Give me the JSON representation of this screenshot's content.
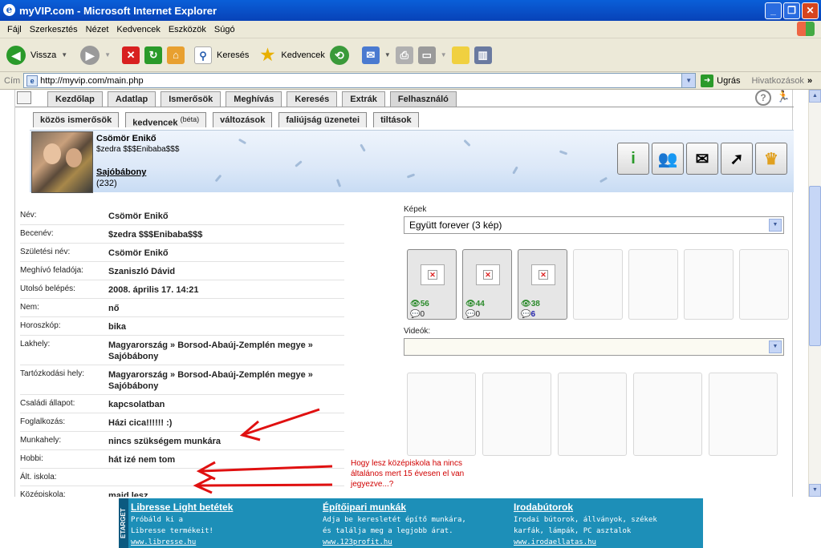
{
  "window": {
    "title": "myVIP.com - Microsoft Internet Explorer"
  },
  "menu": [
    "Fájl",
    "Szerkesztés",
    "Nézet",
    "Kedvencek",
    "Eszközök",
    "Súgó"
  ],
  "toolbar": {
    "back": "Vissza",
    "search": "Keresés",
    "favorites": "Kedvencek"
  },
  "address": {
    "label": "Cím",
    "url": "http://myvip.com/main.php",
    "go": "Ugrás",
    "links": "Hivatkozások"
  },
  "tabs_main": [
    "Kezdőlap",
    "Adatlap",
    "Ismerősök",
    "Meghívás",
    "Keresés",
    "Extrák",
    "Felhasználó"
  ],
  "tabs_sub": [
    "közös ismerősök",
    "kedvencek",
    "változások",
    "faliújság üzenetei",
    "tiltások"
  ],
  "tabs_sub_note": "(béta)",
  "profile": {
    "name": "Csömör Enikő",
    "nick": "$zedra $$$Enibaba$$$",
    "town": "Sajóbábony",
    "count": "(232)"
  },
  "info_rows": [
    {
      "k": "Név:",
      "v": "Csömör Enikő"
    },
    {
      "k": "Becenév:",
      "v": "$zedra $$$Enibaba$$$"
    },
    {
      "k": "Születési név:",
      "v": "Csömör Enikő"
    },
    {
      "k": "Meghívó feladója:",
      "v": "Szaniszló Dávid"
    },
    {
      "k": "Utolsó belépés:",
      "v": "2008. április 17. 14:21"
    },
    {
      "k": "Nem:",
      "v": "nő"
    },
    {
      "k": "Horoszkóp:",
      "v": "bika"
    },
    {
      "k": "Lakhely:",
      "v": "Magyarország » Borsod-Abaúj-Zemplén megye » Sajóbábony"
    },
    {
      "k": "Tartózkodási hely:",
      "v": "Magyarország » Borsod-Abaúj-Zemplén megye » Sajóbábony"
    },
    {
      "k": "Családi állapot:",
      "v": "kapcsolatban"
    },
    {
      "k": "Foglalkozás:",
      "v": "Házi cica!!!!!! :)"
    },
    {
      "k": "Munkahely:",
      "v": "nincs szükségem munkára"
    },
    {
      "k": "Hobbi:",
      "v": "hát izé nem tom"
    },
    {
      "k": "Ált. iskola:",
      "v": ""
    },
    {
      "k": "Középiskola:",
      "v": "majd lesz"
    }
  ],
  "pictures": {
    "label": "Képek",
    "selected": "Együtt forever (3 kép)",
    "items": [
      {
        "views": "56",
        "comments": "0"
      },
      {
        "views": "44",
        "comments": "0"
      },
      {
        "views": "38",
        "comments": "6"
      }
    ]
  },
  "videos": {
    "label": "Videók:",
    "selected": ""
  },
  "annotation": "Hogy lesz középiskola ha nincs általános mert 15 évesen el van jegyezve...?",
  "ads": {
    "side": "ETARGET",
    "items": [
      {
        "title": "Libresse Light betétek",
        "l1": "Próbáld ki a",
        "l2": "Libresse termékeit!",
        "url": "www.libresse.hu"
      },
      {
        "title": "Építőipari munkák",
        "l1": "Adja be keresletét építő munkára,",
        "l2": "és találja meg a legjobb árat.",
        "url": "www.123profit.hu"
      },
      {
        "title": "Irodabútorok",
        "l1": "Irodai bútorok, állványok, székek",
        "l2": "karfák, lámpák, PC asztalok",
        "url": "www.irodaellatas.hu"
      }
    ]
  },
  "colors": {
    "titlebar": "#0a5fd8",
    "annotation": "#d00000",
    "ad_bg": "#1d8fb8"
  }
}
